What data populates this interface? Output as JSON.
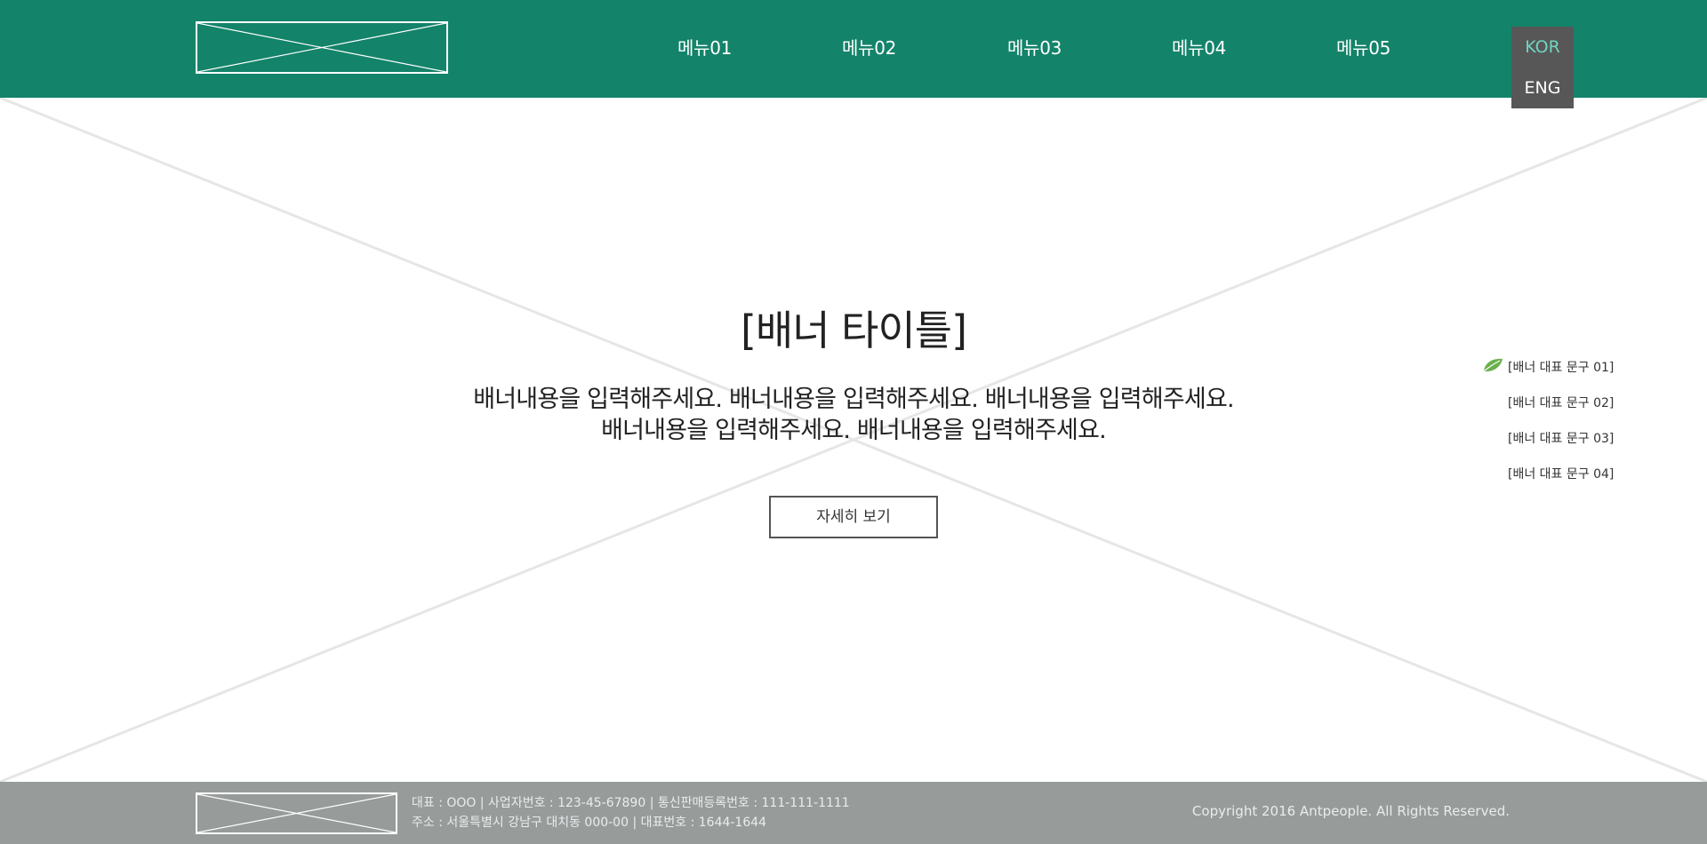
{
  "header": {
    "logo_icon": "image-placeholder-icon",
    "menu": [
      {
        "label": "메뉴01"
      },
      {
        "label": "메뉴02"
      },
      {
        "label": "메뉴03"
      },
      {
        "label": "메뉴04"
      },
      {
        "label": "메뉴05"
      }
    ],
    "languages": {
      "active": "KOR",
      "other": "ENG"
    }
  },
  "banner": {
    "title": "[배너 타이틀]",
    "description_line1": "배너내용을 입력해주세요. 배너내용을 입력해주세요. 배너내용을 입력해주세요.",
    "description_line2": "배너내용을 입력해주세요. 배너내용을 입력해주세요.",
    "button_label": "자세히 보기",
    "slides": [
      {
        "label": "[배너 대표 문구 01]",
        "active": true
      },
      {
        "label": "[배너 대표 문구 02]",
        "active": false
      },
      {
        "label": "[배너 대표 문구 03]",
        "active": false
      },
      {
        "label": "[배너 대표 문구 04]",
        "active": false
      }
    ],
    "active_indicator_icon": "leaf-icon"
  },
  "footer": {
    "logo_icon": "image-placeholder-icon",
    "info_line1": "대표 : OOO  |  사업자번호 : 123-45-67890  |  통신판매등록번호 : 111-111-1111",
    "info_line2": "주소 : 서울특별시 강남구 대치동 000-00  |  대표번호 : 1644-1644",
    "copyright": "Copyright 2016 Antpeople. All Rights Reserved."
  },
  "colors": {
    "header_bg": "#13836a",
    "lang_box_bg": "#575757",
    "lang_active": "#6fd5c0",
    "footer_bg": "#979c9b",
    "leaf": "#6ab04c"
  }
}
